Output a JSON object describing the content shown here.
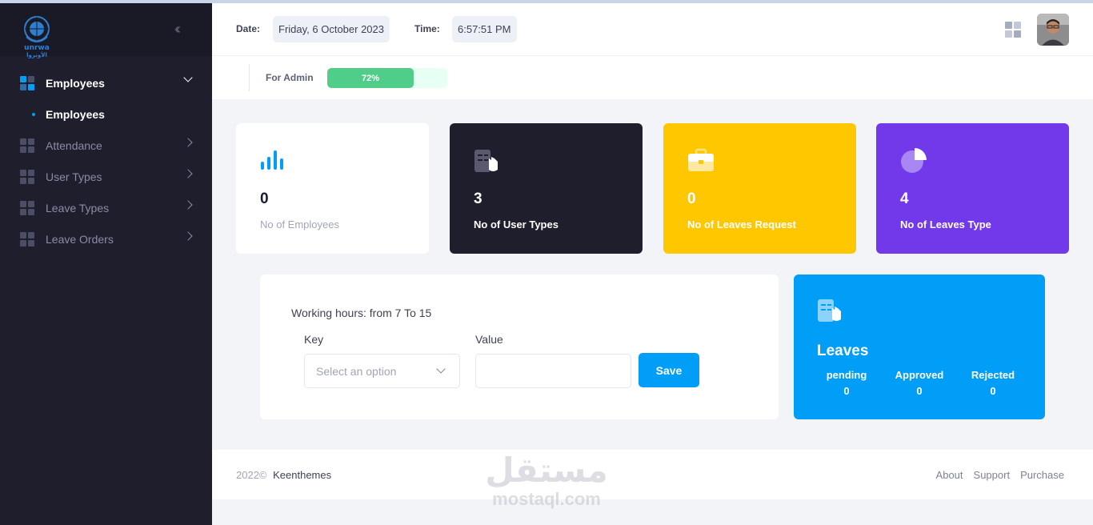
{
  "sidebar": {
    "logo_text": "unrwa",
    "logo_text_ar": "الأونروا",
    "menu": [
      {
        "label": "Employees",
        "active": true
      },
      {
        "label": "Attendance"
      },
      {
        "label": "User Types"
      },
      {
        "label": "Leave Types"
      },
      {
        "label": "Leave Orders"
      }
    ],
    "submenu": [
      {
        "label": "Employees"
      }
    ]
  },
  "header": {
    "date_label": "Date:",
    "date_value": "Friday, 6 October 2023",
    "time_label": "Time:",
    "time_value": "6:57:51 PM"
  },
  "toolbar": {
    "label": "For Admin",
    "progress_label": "72%",
    "progress_percent": 72
  },
  "stats": [
    {
      "value": "0",
      "label": "No of Employees",
      "bg": "#ffffff",
      "text": "#181c32",
      "label_color": "#a1a5b7",
      "icon": "chart-bars-icon"
    },
    {
      "value": "3",
      "label": "No of User Types",
      "bg": "#1e1e2d",
      "text": "#ffffff",
      "label_color": "#ffffff",
      "icon": "document-hand-icon"
    },
    {
      "value": "0",
      "label": "No of Leaves Request",
      "bg": "#ffc700",
      "text": "#ffffff",
      "label_color": "#ffffff",
      "icon": "briefcase-icon"
    },
    {
      "value": "4",
      "label": "No of Leaves Type",
      "bg": "#7239ea",
      "text": "#ffffff",
      "label_color": "#ffffff",
      "icon": "pie-chart-icon"
    }
  ],
  "working": {
    "text": "Working hours: from 7 To 15",
    "key_label": "Key",
    "value_label": "Value",
    "select_placeholder": "Select an option",
    "save_label": "Save"
  },
  "leaves": {
    "title": "Leaves",
    "columns": [
      {
        "label": "pending",
        "value": "0"
      },
      {
        "label": "Approved",
        "value": "0"
      },
      {
        "label": "Rejected",
        "value": "0"
      }
    ]
  },
  "footer": {
    "year": "2022©",
    "brand": "Keenthemes",
    "links": [
      "About",
      "Support",
      "Purchase"
    ]
  },
  "watermark": {
    "ar": "مستقل",
    "en": "mostaql.com"
  },
  "colors": {
    "accent": "#009ef7",
    "success": "#50cd89",
    "sidebar": "#1e1e2d"
  }
}
